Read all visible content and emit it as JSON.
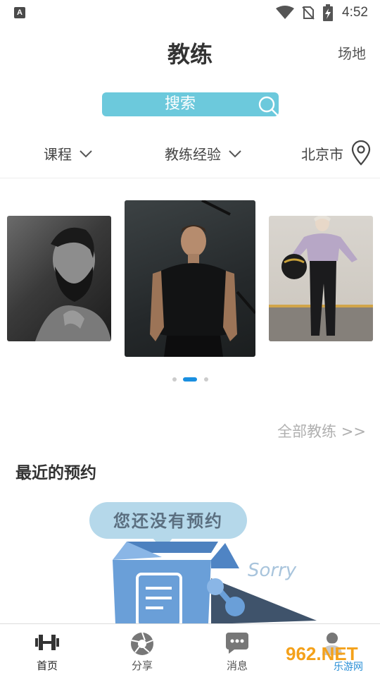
{
  "status_bar": {
    "time": "4:52",
    "notif_icon": "A"
  },
  "header": {
    "title": "教练",
    "venue_link": "场地"
  },
  "search": {
    "placeholder": "搜索"
  },
  "filters": {
    "course": "课程",
    "experience": "教练经验",
    "city": "北京市"
  },
  "carousel": {
    "cards": [
      {
        "name": "coach-card-left"
      },
      {
        "name": "coach-card-center"
      },
      {
        "name": "coach-card-right"
      }
    ],
    "active_index": 1,
    "total": 3
  },
  "all_coaches_link": "全部教练 >>",
  "recent": {
    "title": "最近的预约",
    "empty_text": "您还没有预约",
    "sorry_text": "Sorry"
  },
  "bottom_nav": {
    "items": [
      {
        "label": "首页",
        "icon": "dumbbell-icon"
      },
      {
        "label": "分享",
        "icon": "aperture-icon"
      },
      {
        "label": "消息",
        "icon": "chat-bubble-icon"
      },
      {
        "label": "",
        "icon": "person-icon"
      }
    ]
  },
  "watermark": {
    "text": "962.NET",
    "subtext": "乐游网"
  },
  "colors": {
    "search_bg": "#6cc9dc",
    "active_dot": "#1a8fe0",
    "empty_box": "#6a9fd8"
  }
}
